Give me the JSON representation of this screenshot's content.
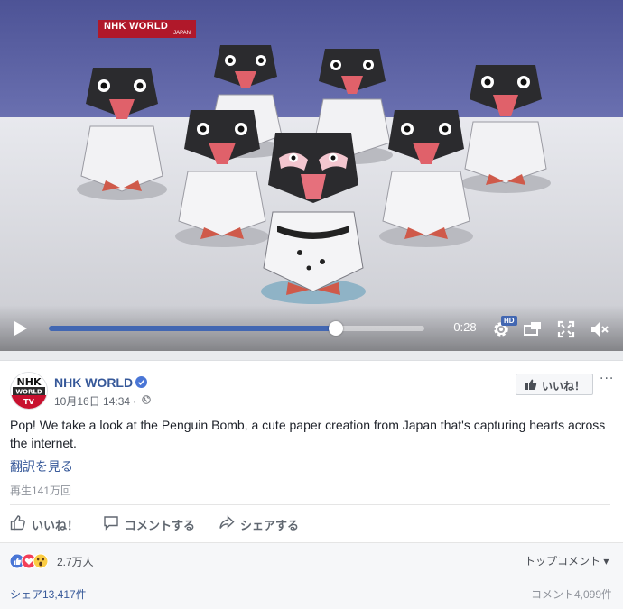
{
  "video": {
    "watermark_main": "NHK WORLD",
    "watermark_sub": "JAPAN",
    "progress_fraction": 0.765,
    "time_remaining": "-0:28",
    "hd_label": "HD",
    "accent_color": "#4267b2"
  },
  "post": {
    "page_name": "NHK WORLD",
    "timestamp": "10月16日 14:34",
    "separator": "·",
    "like_page_label": "いいね！",
    "more_label": "···",
    "text": "Pop! We take a look at the Penguin Bomb, a cute paper creation from Japan that's capturing hearts across the internet.",
    "translate_link": "翻訳を見る",
    "views": "再生141万回"
  },
  "actions": {
    "like": "いいね！",
    "comment": "コメントする",
    "share": "シェアする"
  },
  "reactions": {
    "count": "2.7万人",
    "top_comments": "トップコメント ▾",
    "shares": "シェア13,417件",
    "comments": "コメント4,099件"
  },
  "avatar": {
    "line1": "NHK",
    "line2": "WORLD",
    "line3": "TV"
  },
  "icons": [
    "play-icon",
    "settings-gear-icon",
    "miniplayer-icon",
    "fullscreen-icon",
    "mute-icon",
    "verified-icon",
    "globe-icon",
    "thumbs-up-icon",
    "comment-icon",
    "share-icon",
    "like-reaction-icon",
    "love-reaction-icon",
    "wow-reaction-icon"
  ]
}
